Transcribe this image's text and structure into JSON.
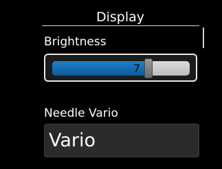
{
  "dialog": {
    "title": "Display"
  },
  "brightness": {
    "label": "Brightness",
    "value": "7",
    "level_fraction": 0.7
  },
  "needle_vario": {
    "label": "Needle Vario",
    "value": "Vario"
  },
  "colors": {
    "background": "#000000",
    "slider_fill": "#1d80c9",
    "slider_track": "#d0d0d0",
    "select_background": "#2b2b2b"
  }
}
